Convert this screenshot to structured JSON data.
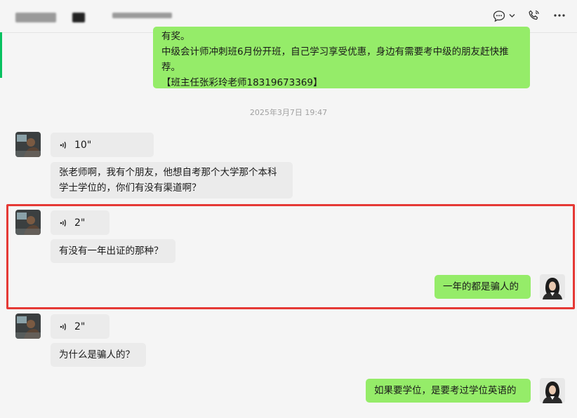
{
  "header": {
    "icons": [
      "chat-bubble-icon",
      "chevron-down-icon",
      "phone-icon",
      "more-icon"
    ]
  },
  "messages": {
    "top_bubble_lines": [
      "有奖。",
      "中级会计师冲刺班6月份开班，自己学习享受优惠，身边有需要考中级的朋友赶快推",
      "荐。",
      "【班主任张彩玲老师18319673369】"
    ],
    "timestamp": "2025年3月7日 19:47",
    "voice1": "10\"",
    "text1_line1": "张老师啊，我有个朋友，他想自考那个大学那个本科",
    "text1_line2": "学士学位的，你们有没有渠道啊？",
    "voice2": "2\"",
    "text2": "有没有一年出证的那种？",
    "reply1": "一年的都是骗人的",
    "voice3": "2\"",
    "text3": "为什么是骗人的？",
    "reply2": "如果要学位，是要考过学位英语的"
  },
  "colors": {
    "outgoing_bubble": "#95ec69",
    "incoming_bubble": "#ebebeb",
    "highlight_border": "#e53935"
  }
}
